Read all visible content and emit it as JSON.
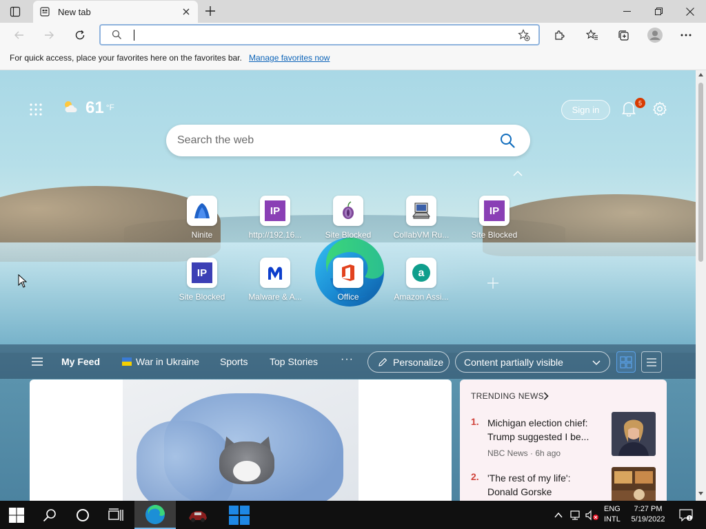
{
  "browser": {
    "tab_title": "New tab",
    "address_value": "",
    "favorites_message": "For quick access, place your favorites here on the favorites bar.",
    "favorites_link": "Manage favorites now"
  },
  "newtab": {
    "weather_temp": "61",
    "weather_unit": "°F",
    "sign_in_label": "Sign in",
    "notification_count": "5",
    "search_placeholder": "Search the web",
    "tiles": [
      {
        "label": "Ninite",
        "icon": "ninite-icon"
      },
      {
        "label": "http://192.16...",
        "icon": "ip-icon"
      },
      {
        "label": "Site Blocked",
        "icon": "tor-icon"
      },
      {
        "label": "CollabVM Ru...",
        "icon": "computer-icon"
      },
      {
        "label": "Site Blocked",
        "icon": "ip-icon"
      },
      {
        "label": "Site Blocked",
        "icon": "ip-icon"
      },
      {
        "label": "Malware & A...",
        "icon": "malwarebytes-icon"
      },
      {
        "label": "Office",
        "icon": "office-icon"
      },
      {
        "label": "Amazon Assi...",
        "icon": "amazon-assistant-icon"
      }
    ]
  },
  "feed": {
    "tabs": [
      "My Feed",
      "War in Ukraine",
      "Sports",
      "Top Stories"
    ],
    "more": "···",
    "personalize_label": "Personalize",
    "content_visibility": "Content partially visible",
    "trending_header": "TRENDING NEWS",
    "trending": [
      {
        "num": "1.",
        "title": "Michigan election chief: Trump suggested I be...",
        "meta": "NBC News · 6h ago"
      },
      {
        "num": "2.",
        "title": "'The rest of my life': Donald Gorske celebrate...",
        "meta": ""
      }
    ]
  },
  "taskbar": {
    "lang_top": "ENG",
    "lang_bottom": "INTL",
    "time": "7:27 PM",
    "date": "5/19/2022",
    "notif_count": "1"
  },
  "colors": {
    "accent": "#0b63b8",
    "badge": "#d83b01",
    "ip_tile": "#8a3fb5",
    "trend_number": "#d0433b"
  }
}
